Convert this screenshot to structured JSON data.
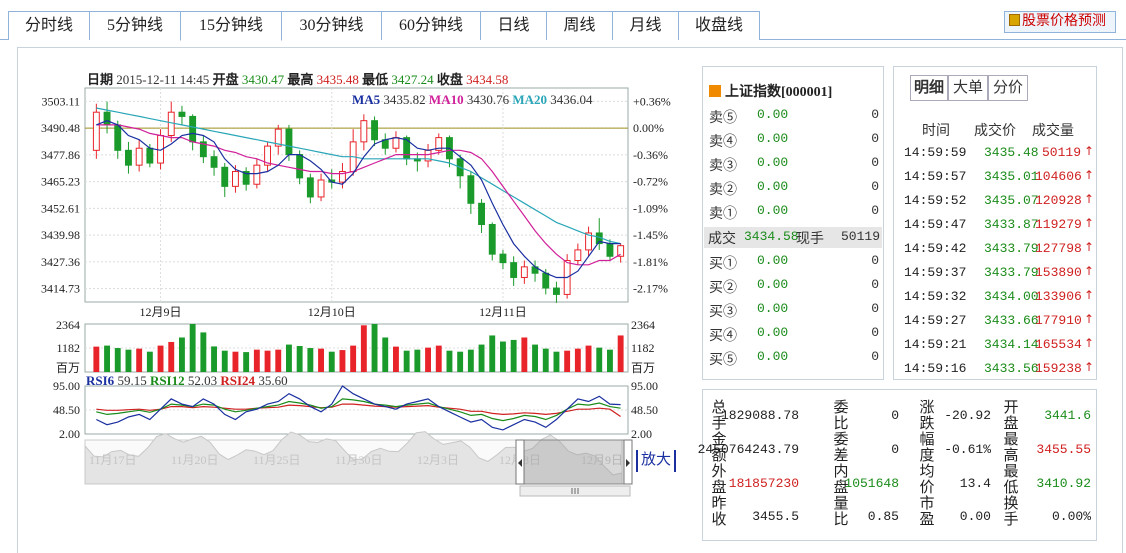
{
  "tabs": [
    {
      "label": "分时线",
      "active": false
    },
    {
      "label": "5分钟线",
      "active": false
    },
    {
      "label": "15分钟线",
      "active": true
    },
    {
      "label": "30分钟线",
      "active": false
    },
    {
      "label": "60分钟线",
      "active": false
    },
    {
      "label": "日线",
      "active": false
    },
    {
      "label": "周线",
      "active": false
    },
    {
      "label": "月线",
      "active": false
    },
    {
      "label": "收盘线",
      "active": false
    }
  ],
  "predict_label": "股票价格预测",
  "info": {
    "date_label": "日期",
    "date": "2015-12-11 14:45",
    "open_label": "开盘",
    "open": "3430.47",
    "high_label": "最高",
    "high": "3435.48",
    "low_label": "最低",
    "low": "3427.24",
    "close_label": "收盘",
    "close": "3434.58"
  },
  "ma_legend": [
    {
      "name": "MA5",
      "value": "3435.82"
    },
    {
      "name": "MA10",
      "value": "3430.76"
    },
    {
      "name": "MA20",
      "value": "3436.04"
    }
  ],
  "rsi_legend": [
    {
      "name": "RSI6",
      "value": "59.15"
    },
    {
      "name": "RSI12",
      "value": "52.03"
    },
    {
      "name": "RSI24",
      "value": "35.60"
    }
  ],
  "zoom_label": "放大",
  "chart_data": {
    "type": "candlestick",
    "price_ticks": [
      "3503.11",
      "3490.48",
      "3477.86",
      "3465.23",
      "3452.61",
      "3439.98",
      "3427.36",
      "3414.73"
    ],
    "pct_ticks": [
      "+0.36%",
      "0.00%",
      "-0.36%",
      "-0.72%",
      "-1.09%",
      "-1.45%",
      "-1.81%",
      "-2.17%"
    ],
    "ylim": [
      3408.42,
      3509.42
    ],
    "ref_close": 3490.48,
    "date_labels": [
      {
        "label": "12月9日",
        "index": 6
      },
      {
        "label": "12月10日",
        "index": 22
      },
      {
        "label": "12月11日",
        "index": 38
      }
    ],
    "volume_ticks": [
      "2364",
      "1182",
      "百万"
    ],
    "volume_max": 2364,
    "rsi_ticks": [
      "95.00",
      "48.50",
      "2.00"
    ],
    "rsi_range": [
      2,
      95
    ],
    "nav_labels": [
      "11月17日",
      "11月20日",
      "11月25日",
      "11月30日",
      "12月3日",
      "12月8日",
      "12月9日",
      "12月"
    ],
    "candles": [
      [
        3480,
        3498,
        3502,
        3476
      ],
      [
        3498,
        3492,
        3503,
        3488
      ],
      [
        3492,
        3480,
        3494,
        3476
      ],
      [
        3480,
        3473,
        3484,
        3469
      ],
      [
        3473,
        3481,
        3485,
        3470
      ],
      [
        3481,
        3474,
        3483,
        3472
      ],
      [
        3474,
        3487,
        3490,
        3471
      ],
      [
        3487,
        3498,
        3503,
        3484
      ],
      [
        3498,
        3496,
        3501,
        3492
      ],
      [
        3496,
        3484,
        3497,
        3480
      ],
      [
        3484,
        3477,
        3487,
        3474
      ],
      [
        3477,
        3472,
        3480,
        3468
      ],
      [
        3472,
        3463,
        3474,
        3458
      ],
      [
        3463,
        3470,
        3473,
        3460
      ],
      [
        3470,
        3464,
        3472,
        3461
      ],
      [
        3464,
        3473,
        3476,
        3462
      ],
      [
        3473,
        3482,
        3484,
        3470
      ],
      [
        3482,
        3490,
        3492,
        3478
      ],
      [
        3490,
        3478,
        3492,
        3475
      ],
      [
        3478,
        3467,
        3480,
        3464
      ],
      [
        3467,
        3458,
        3469,
        3455
      ],
      [
        3458,
        3466,
        3469,
        3456
      ],
      [
        3466,
        3465,
        3471,
        3462
      ],
      [
        3465,
        3470,
        3474,
        3462
      ],
      [
        3470,
        3484,
        3490,
        3468
      ],
      [
        3484,
        3494,
        3497,
        3480
      ],
      [
        3494,
        3485,
        3496,
        3482
      ],
      [
        3485,
        3481,
        3488,
        3478
      ],
      [
        3481,
        3486,
        3489,
        3479
      ],
      [
        3486,
        3476,
        3487,
        3473
      ],
      [
        3476,
        3475,
        3479,
        3470
      ],
      [
        3475,
        3480,
        3483,
        3472
      ],
      [
        3480,
        3486,
        3488,
        3478
      ],
      [
        3486,
        3476,
        3487,
        3472
      ],
      [
        3476,
        3468,
        3478,
        3462
      ],
      [
        3468,
        3455,
        3470,
        3450
      ],
      [
        3455,
        3445,
        3457,
        3441
      ],
      [
        3445,
        3431,
        3446,
        3428
      ],
      [
        3431,
        3427,
        3433,
        3424
      ],
      [
        3427,
        3420,
        3430,
        3416
      ],
      [
        3420,
        3425,
        3428,
        3417
      ],
      [
        3425,
        3422,
        3428,
        3418
      ],
      [
        3422,
        3415,
        3424,
        3412
      ],
      [
        3415,
        3412,
        3418,
        3408
      ],
      [
        3412,
        3428,
        3431,
        3410
      ],
      [
        3428,
        3433,
        3436,
        3426
      ],
      [
        3433,
        3441,
        3444,
        3430
      ],
      [
        3441,
        3436,
        3448,
        3433
      ],
      [
        3436,
        3430,
        3438,
        3428
      ],
      [
        3430,
        3435,
        3436,
        3427
      ]
    ],
    "volume": [
      1250,
      1300,
      1180,
      1100,
      1150,
      1000,
      1300,
      1480,
      1700,
      2364,
      1950,
      1260,
      1050,
      1000,
      980,
      1100,
      1050,
      1100,
      1350,
      1280,
      1180,
      1150,
      1000,
      1080,
      1300,
      2300,
      2364,
      1700,
      1250,
      1050,
      1100,
      1200,
      1300,
      1050,
      1000,
      1100,
      1350,
      1800,
      1500,
      1580,
      1700,
      1350,
      1150,
      1000,
      1050,
      1150,
      1300,
      1200,
      1100,
      1800
    ],
    "rsi6": [
      30,
      20,
      25,
      35,
      40,
      30,
      50,
      70,
      60,
      55,
      70,
      60,
      40,
      30,
      45,
      50,
      60,
      65,
      80,
      70,
      55,
      45,
      60,
      95,
      80,
      70,
      60,
      55,
      50,
      60,
      65,
      70,
      55,
      45,
      35,
      25,
      30,
      15,
      10,
      20,
      30,
      25,
      15,
      30,
      50,
      70,
      65,
      75,
      60,
      59
    ],
    "rsi12": [
      45,
      40,
      42,
      45,
      48,
      44,
      50,
      60,
      58,
      55,
      60,
      58,
      50,
      45,
      48,
      52,
      55,
      58,
      65,
      62,
      58,
      52,
      55,
      70,
      68,
      65,
      60,
      58,
      55,
      58,
      60,
      62,
      55,
      50,
      45,
      38,
      40,
      32,
      28,
      32,
      38,
      36,
      30,
      38,
      50,
      60,
      58,
      62,
      55,
      52
    ],
    "rsi24": [
      50,
      48,
      48,
      49,
      50,
      48,
      50,
      55,
      55,
      53,
      55,
      54,
      52,
      50,
      50,
      52,
      53,
      54,
      58,
      57,
      55,
      53,
      54,
      60,
      60,
      58,
      56,
      55,
      54,
      55,
      56,
      57,
      54,
      52,
      50,
      46,
      46,
      42,
      40,
      41,
      43,
      42,
      40,
      42,
      46,
      50,
      50,
      52,
      50,
      36
    ],
    "ma5": [
      3492,
      3494,
      3492,
      3487,
      3485,
      3481,
      3480,
      3483,
      3487,
      3488,
      3487,
      3484,
      3476,
      3471,
      3469,
      3469,
      3470,
      3473,
      3478,
      3478,
      3475,
      3471,
      3465,
      3464,
      3469,
      3477,
      3483,
      3485,
      3486,
      3485,
      3481,
      3480,
      3481,
      3481,
      3477,
      3473,
      3466,
      3455,
      3445,
      3436,
      3430,
      3425,
      3422,
      3420,
      3420,
      3423,
      3430,
      3437,
      3436,
      3436
    ],
    "ma10": [
      3492,
      3492,
      3492,
      3491,
      3490,
      3488,
      3487,
      3486,
      3486,
      3484,
      3483,
      3482,
      3480,
      3479,
      3477,
      3476,
      3474,
      3473,
      3472,
      3471,
      3470,
      3470,
      3469,
      3469,
      3470,
      3472,
      3474,
      3476,
      3478,
      3478,
      3478,
      3478,
      3479,
      3480,
      3480,
      3479,
      3476,
      3470,
      3463,
      3456,
      3449,
      3442,
      3436,
      3431,
      3427,
      3426,
      3426,
      3428,
      3428,
      3431
    ],
    "ma20": [
      3500,
      3499,
      3498,
      3497,
      3496,
      3495,
      3494,
      3493,
      3492,
      3491,
      3490,
      3489,
      3488,
      3487,
      3486,
      3485,
      3484,
      3483,
      3482,
      3481,
      3480,
      3479,
      3478,
      3477,
      3477,
      3476,
      3476,
      3476,
      3476,
      3476,
      3476,
      3476,
      3475,
      3474,
      3472,
      3470,
      3467,
      3464,
      3461,
      3458,
      3455,
      3452,
      3449,
      3446,
      3444,
      3442,
      3440,
      3439,
      3437,
      3436
    ]
  },
  "book": {
    "title": "上证指数[000001]",
    "sells": [
      {
        "label": "卖⑤",
        "price": "0.00",
        "vol": "0"
      },
      {
        "label": "卖④",
        "price": "0.00",
        "vol": "0"
      },
      {
        "label": "卖③",
        "price": "0.00",
        "vol": "0"
      },
      {
        "label": "卖②",
        "price": "0.00",
        "vol": "0"
      },
      {
        "label": "卖①",
        "price": "0.00",
        "vol": "0"
      }
    ],
    "deal": {
      "label": "成交",
      "price": "3434.58",
      "label2": "现手",
      "vol": "50119"
    },
    "buys": [
      {
        "label": "买①",
        "price": "0.00",
        "vol": "0"
      },
      {
        "label": "买②",
        "price": "0.00",
        "vol": "0"
      },
      {
        "label": "买③",
        "price": "0.00",
        "vol": "0"
      },
      {
        "label": "买④",
        "price": "0.00",
        "vol": "0"
      },
      {
        "label": "买⑤",
        "price": "0.00",
        "vol": "0"
      }
    ]
  },
  "trades": {
    "tabs": [
      {
        "label": "明细",
        "active": true
      },
      {
        "label": "大单",
        "active": false
      },
      {
        "label": "分价",
        "active": false
      }
    ],
    "headers": {
      "time": "时间",
      "price": "成交价",
      "vol": "成交量"
    },
    "arrow": "↑",
    "rows": [
      {
        "time": "14:59:59",
        "price": "3435.48",
        "vol": "50119"
      },
      {
        "time": "14:59:57",
        "price": "3435.01",
        "vol": "104606"
      },
      {
        "time": "14:59:52",
        "price": "3435.07",
        "vol": "120928"
      },
      {
        "time": "14:59:47",
        "price": "3433.87",
        "vol": "119279"
      },
      {
        "time": "14:59:42",
        "price": "3433.79",
        "vol": "127798"
      },
      {
        "time": "14:59:37",
        "price": "3433.79",
        "vol": "153890"
      },
      {
        "time": "14:59:32",
        "price": "3434.00",
        "vol": "133906"
      },
      {
        "time": "14:59:27",
        "price": "3433.66",
        "vol": "177910"
      },
      {
        "time": "14:59:21",
        "price": "3434.14",
        "vol": "165534"
      },
      {
        "time": "14:59:16",
        "price": "3433.56",
        "vol": "159238"
      }
    ]
  },
  "stats": {
    "labels": {
      "c1": "总手金额外盘昨收",
      "c2": "委比委差内盘量比",
      "c3": "涨跌幅度均价市盈",
      "c4": "开盘最高最低换手"
    },
    "col1": [
      {
        "v": "1829088.78",
        "c": "#222"
      },
      {
        "v": "2450764243.79",
        "c": "#222"
      },
      {
        "v": "181857230",
        "c": "#d02020"
      },
      {
        "v": "3455.5",
        "c": "#222"
      }
    ],
    "col2": [
      {
        "v": "0",
        "c": "#222"
      },
      {
        "v": "0",
        "c": "#222"
      },
      {
        "v": "1051648",
        "c": "#1a8c1a"
      },
      {
        "v": "0.85",
        "c": "#222"
      }
    ],
    "col3": [
      {
        "v": "-20.92",
        "c": "#222"
      },
      {
        "v": "-0.61%",
        "c": "#222"
      },
      {
        "v": "13.4",
        "c": "#222"
      },
      {
        "v": "0.00",
        "c": "#222"
      }
    ],
    "col4": [
      {
        "v": "3441.6",
        "c": "#1a8c1a"
      },
      {
        "v": "3455.55",
        "c": "#d02020"
      },
      {
        "v": "3410.92",
        "c": "#1a8c1a"
      },
      {
        "v": "0.00%",
        "c": "#222"
      }
    ]
  },
  "colors": {
    "up": "#e8242a",
    "down": "#1a9a2a",
    "ma5": "#1a2fa0",
    "ma10": "#d0209a",
    "ma20": "#2aa6b8",
    "grid": "#dcdcdc"
  }
}
